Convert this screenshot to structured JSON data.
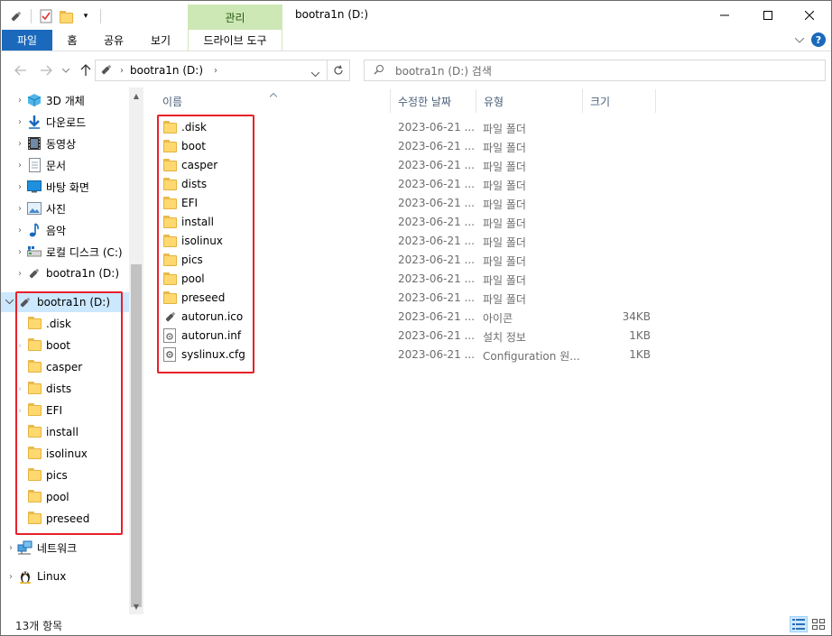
{
  "window": {
    "title": "bootra1n (D:)",
    "manage_tab": "관리",
    "controls": {
      "minimize": "—",
      "maximize": "☐",
      "close": "✕"
    }
  },
  "ribbon": {
    "tabs": [
      "파일",
      "홈",
      "공유",
      "보기"
    ],
    "drive_tools": "드라이브 도구",
    "help": "?"
  },
  "address": {
    "path": "bootra1n (D:)",
    "search_placeholder": "bootra1n (D:) 검색"
  },
  "nav": {
    "items": [
      {
        "label": "3D 개체",
        "icon": "3d-objects-icon"
      },
      {
        "label": "다운로드",
        "icon": "downloads-icon"
      },
      {
        "label": "동영상",
        "icon": "videos-icon"
      },
      {
        "label": "문서",
        "icon": "documents-icon"
      },
      {
        "label": "바탕 화면",
        "icon": "desktop-icon"
      },
      {
        "label": "사진",
        "icon": "pictures-icon"
      },
      {
        "label": "음악",
        "icon": "music-icon"
      },
      {
        "label": "로컬 디스크 (C:)",
        "icon": "local-disk-icon"
      },
      {
        "label": "bootra1n (D:)",
        "icon": "usb-drive-icon"
      }
    ],
    "expanded_drive": "bootra1n (D:)",
    "sub_items": [
      ".disk",
      "boot",
      "casper",
      "dists",
      "EFI",
      "install",
      "isolinux",
      "pics",
      "pool",
      "preseed"
    ],
    "network": "네트워크",
    "linux": "Linux"
  },
  "columns": {
    "name": "이름",
    "date": "수정한 날짜",
    "type": "유형",
    "size": "크기"
  },
  "files": [
    {
      "name": ".disk",
      "date": "2023-06-21 ...",
      "type": "파일 폴더",
      "size": "",
      "kind": "folder"
    },
    {
      "name": "boot",
      "date": "2023-06-21 ...",
      "type": "파일 폴더",
      "size": "",
      "kind": "folder"
    },
    {
      "name": "casper",
      "date": "2023-06-21 ...",
      "type": "파일 폴더",
      "size": "",
      "kind": "folder"
    },
    {
      "name": "dists",
      "date": "2023-06-21 ...",
      "type": "파일 폴더",
      "size": "",
      "kind": "folder"
    },
    {
      "name": "EFI",
      "date": "2023-06-21 ...",
      "type": "파일 폴더",
      "size": "",
      "kind": "folder"
    },
    {
      "name": "install",
      "date": "2023-06-21 ...",
      "type": "파일 폴더",
      "size": "",
      "kind": "folder"
    },
    {
      "name": "isolinux",
      "date": "2023-06-21 ...",
      "type": "파일 폴더",
      "size": "",
      "kind": "folder"
    },
    {
      "name": "pics",
      "date": "2023-06-21 ...",
      "type": "파일 폴더",
      "size": "",
      "kind": "folder"
    },
    {
      "name": "pool",
      "date": "2023-06-21 ...",
      "type": "파일 폴더",
      "size": "",
      "kind": "folder"
    },
    {
      "name": "preseed",
      "date": "2023-06-21 ...",
      "type": "파일 폴더",
      "size": "",
      "kind": "folder"
    },
    {
      "name": "autorun.ico",
      "date": "2023-06-21 ...",
      "type": "아이콘",
      "size": "34KB",
      "kind": "ico"
    },
    {
      "name": "autorun.inf",
      "date": "2023-06-21 ...",
      "type": "설치 정보",
      "size": "1KB",
      "kind": "inf"
    },
    {
      "name": "syslinux.cfg",
      "date": "2023-06-21 ...",
      "type": "Configuration 원...",
      "size": "1KB",
      "kind": "cfg"
    }
  ],
  "status": {
    "count": "13개 항목"
  },
  "colors": {
    "accent": "#1a69bc",
    "manage": "#cde8b5",
    "highlight": "#e8202a",
    "selected": "#cce8ff"
  }
}
